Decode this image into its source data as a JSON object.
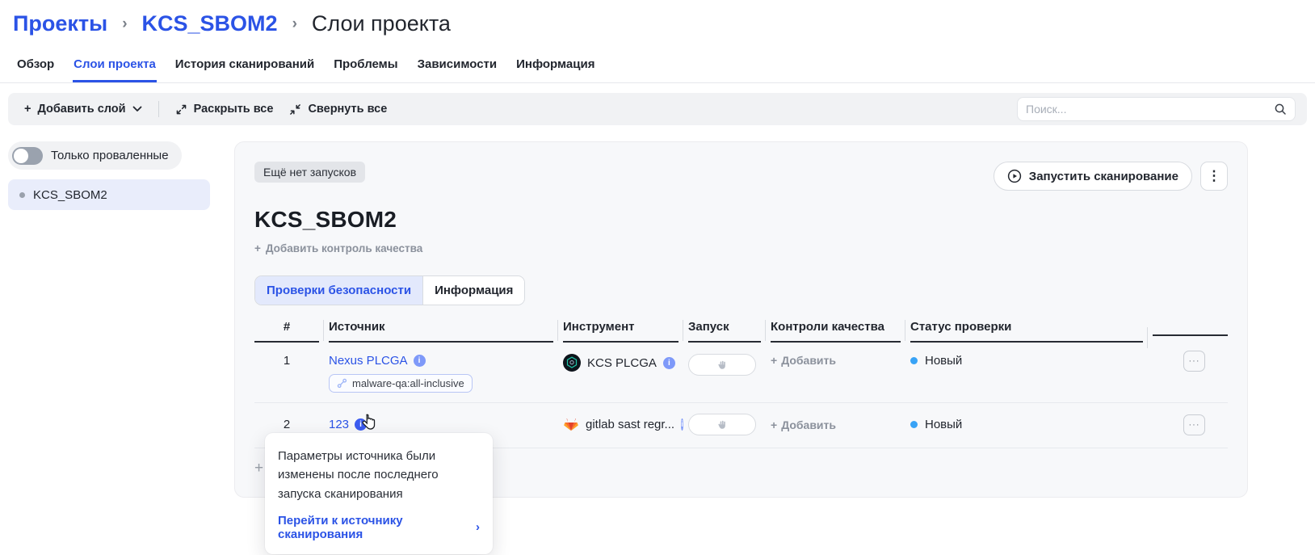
{
  "breadcrumb": {
    "items": [
      "Проекты",
      "KCS_SBOM2",
      "Слои проекта"
    ],
    "separator": "›"
  },
  "tabs": [
    {
      "label": "Обзор",
      "active": false
    },
    {
      "label": "Слои проекта",
      "active": true
    },
    {
      "label": "История сканирований",
      "active": false
    },
    {
      "label": "Проблемы",
      "active": false
    },
    {
      "label": "Зависимости",
      "active": false
    },
    {
      "label": "Информация",
      "active": false
    }
  ],
  "toolbar": {
    "add_layer_label": "Добавить слой",
    "expand_all_label": "Раскрыть все",
    "collapse_all_label": "Свернуть все",
    "search_placeholder": "Поиск..."
  },
  "sidebar": {
    "toggle_label": "Только проваленные",
    "toggle_state": "off",
    "items": [
      {
        "label": "KCS_SBOM2",
        "selected": true
      }
    ]
  },
  "panel": {
    "status_badge": "Ещё нет запусков",
    "run_scan_label": "Запустить сканирование",
    "title": "KCS_SBOM2",
    "add_quality_control_label": "Добавить контроль качества",
    "inner_tabs": [
      {
        "label": "Проверки безопасности",
        "active": true
      },
      {
        "label": "Информация",
        "active": false
      }
    ],
    "table": {
      "columns": [
        "#",
        "Источник",
        "Инструмент",
        "Запуск",
        "Контроли качества",
        "Статус проверки"
      ],
      "rows": [
        {
          "num": "1",
          "source": "Nexus PLCGA",
          "source_tag": "malware-qa:all-inclusive",
          "tool": "KCS PLCGA",
          "quality_add_label": "Добавить",
          "status": "Новый"
        },
        {
          "num": "2",
          "source": "123",
          "tool": "gitlab sast regr...",
          "quality_add_label": "Добавить",
          "status": "Новый"
        }
      ]
    }
  },
  "tooltip": {
    "message": "Параметры источника были изменены после последнего запуска сканирования",
    "link_label": "Перейти к источнику сканирования",
    "link_chevron": "›"
  },
  "icons": {
    "plus": "+",
    "kebab": "⋮",
    "ellipsis": "···",
    "info": "i"
  },
  "colors": {
    "accent_blue": "#2b53e6",
    "status_dot_blue": "#38a3f6",
    "info_icon_blue": "#7e99f9",
    "info_icon_blue_hover": "#3c5cf0",
    "card_background": "#f7f8fa",
    "toolbar_background": "#f1f2f4",
    "selected_item_background": "#e9edfb",
    "gitlab_orange": "#e24329"
  }
}
